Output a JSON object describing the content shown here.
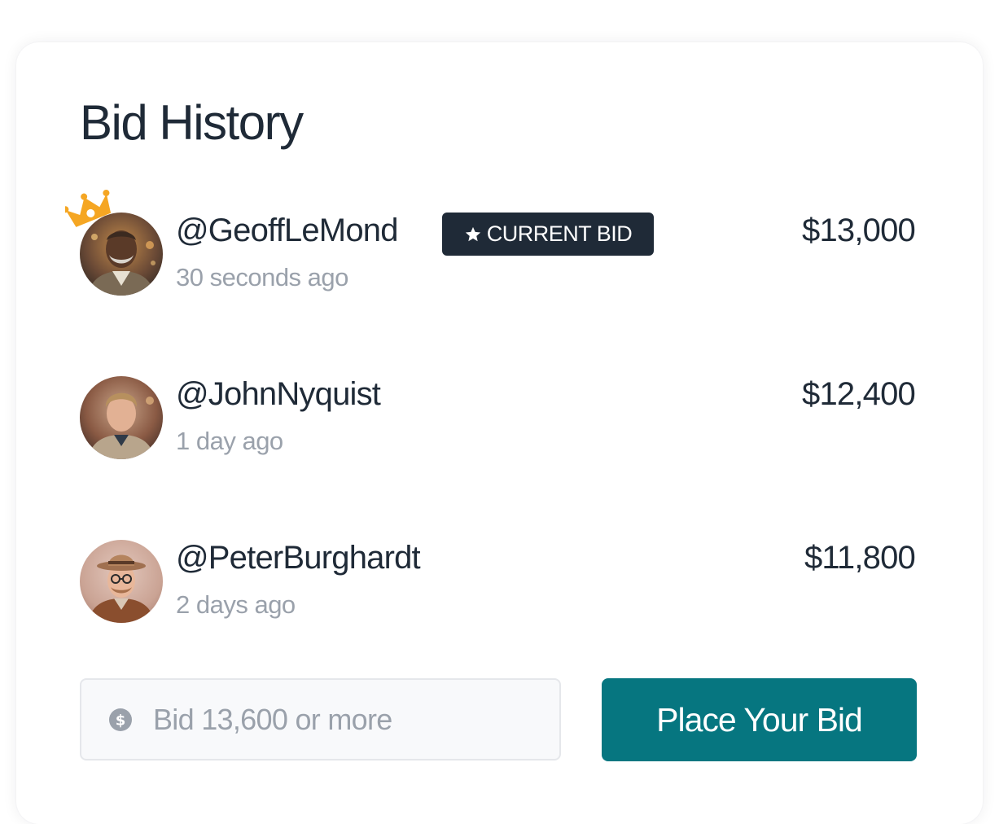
{
  "card": {
    "title": "Bid History"
  },
  "bids": [
    {
      "username": "@GeoffLeMond",
      "time": "30 seconds ago",
      "amount": "$13,000",
      "badge": "CURRENT BID",
      "badge_icon": "star-icon",
      "leader_icon": "crown-icon"
    },
    {
      "username": "@JohnNyquist",
      "time": "1 day ago",
      "amount": "$12,400"
    },
    {
      "username": "@PeterBurghardt",
      "time": "2 days ago",
      "amount": "$11,800"
    }
  ],
  "bid_form": {
    "input_icon": "dollar-circle-icon",
    "placeholder": "Bid 13,600 or more",
    "value": "",
    "button_label": "Place Your Bid"
  },
  "colors": {
    "text_primary": "#1f2a37",
    "text_secondary": "#9aa1ab",
    "badge_bg": "#1f2a37",
    "button_bg": "#067680",
    "crown": "#f5a623",
    "input_bg": "#f8f9fb"
  }
}
